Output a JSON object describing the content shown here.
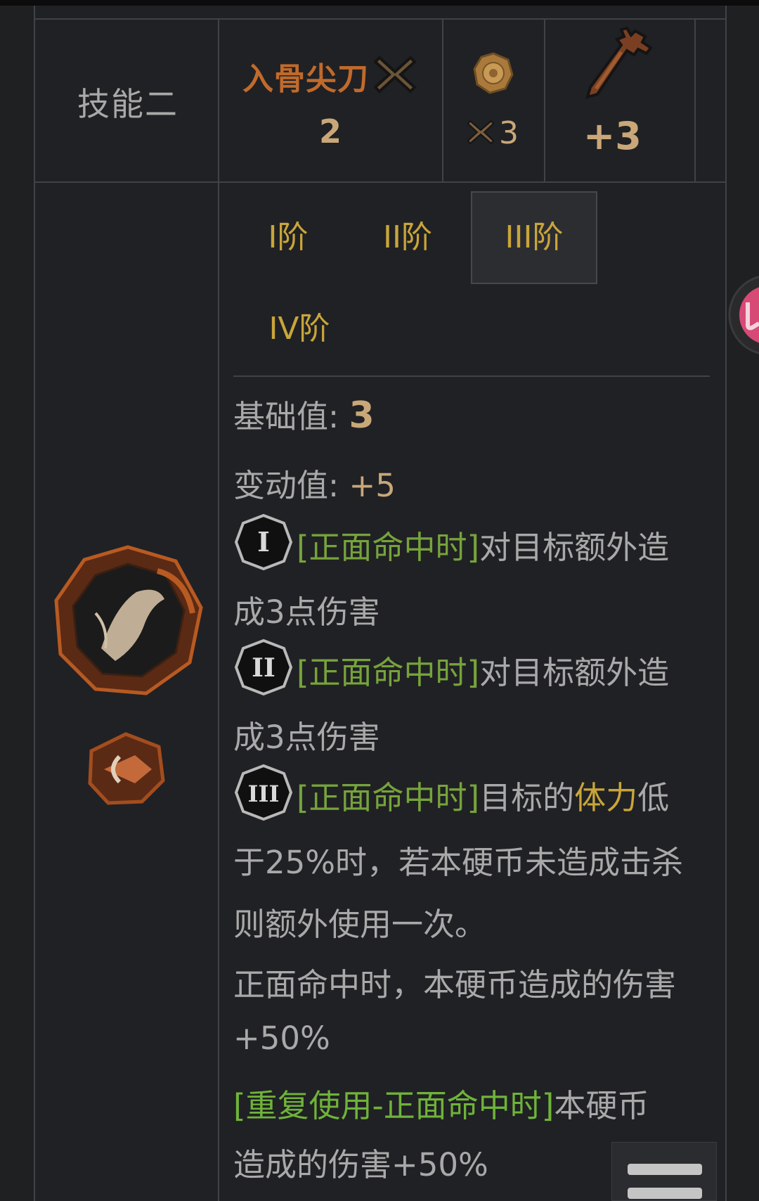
{
  "skill": {
    "label": "技能二",
    "name": "入骨尖刀",
    "count": "2",
    "coin_multiplier": "3",
    "power": "+3",
    "icons": {
      "x": "x-mark-icon",
      "coin": "coin-icon",
      "weapon": "dagger-icon",
      "skill_emblem": "slash-skill-emblem-icon",
      "attack_type": "pierce-attack-type-icon"
    }
  },
  "tabs": [
    {
      "label": "I阶",
      "active": false
    },
    {
      "label": "II阶",
      "active": false
    },
    {
      "label": "III阶",
      "active": true
    },
    {
      "label": "IV阶",
      "active": false
    }
  ],
  "stats": {
    "base_label": "基础值:",
    "base_value": "3",
    "variance_label": "变动值:",
    "variance_value": "+5"
  },
  "coins": [
    {
      "badge": "I",
      "trigger": "[正面命中时]",
      "line1": "对目标额外造",
      "line2": "成3点伤害"
    },
    {
      "badge": "II",
      "trigger": "[正面命中时]",
      "line1": "对目标额外造",
      "line2": "成3点伤害"
    },
    {
      "badge": "III",
      "trigger": "[正面命中时]",
      "line1_pre": "目标的",
      "line1_key": "体力",
      "line1_post": "低",
      "line2": "于25%时，若本硬币未造成击杀",
      "line3": "则额外使用一次。",
      "line4": "正面命中时，本硬币造成的伤害",
      "line5": "+50%",
      "repeat_trigger": "[重复使用-正面命中时]",
      "repeat_line1": "本硬币",
      "repeat_line2": "造成的伤害+50%"
    }
  ],
  "colors": {
    "background": "#1f2022",
    "border": "#3e4348",
    "skill_name": "#c06a2c",
    "tab_text": "#c9a53a",
    "trigger_green": "#76a33c",
    "keyword_yellow": "#c9a53a",
    "number": "#c9a779"
  },
  "widgets": {
    "side_tab_icon": "pink-floating-tab-icon",
    "menu_icon": "hamburger-menu-icon"
  }
}
